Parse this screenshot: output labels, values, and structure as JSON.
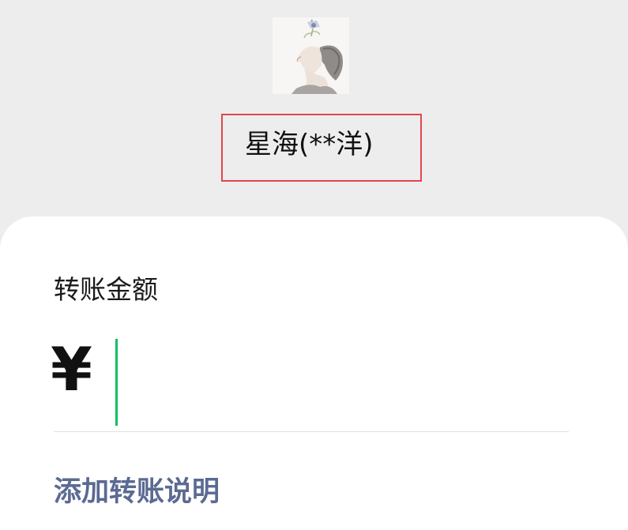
{
  "recipient": {
    "display_name": "星海(**洋)",
    "avatar_icon": "user-avatar-illustration"
  },
  "transfer": {
    "amount_label": "转账金额",
    "currency_symbol": "¥",
    "amount_value": "",
    "add_note_label": "添加转账说明"
  },
  "colors": {
    "background": "#ededed",
    "card": "#ffffff",
    "highlight_box": "#e0474c",
    "cursor": "#07c160",
    "link": "#5b6a92"
  }
}
